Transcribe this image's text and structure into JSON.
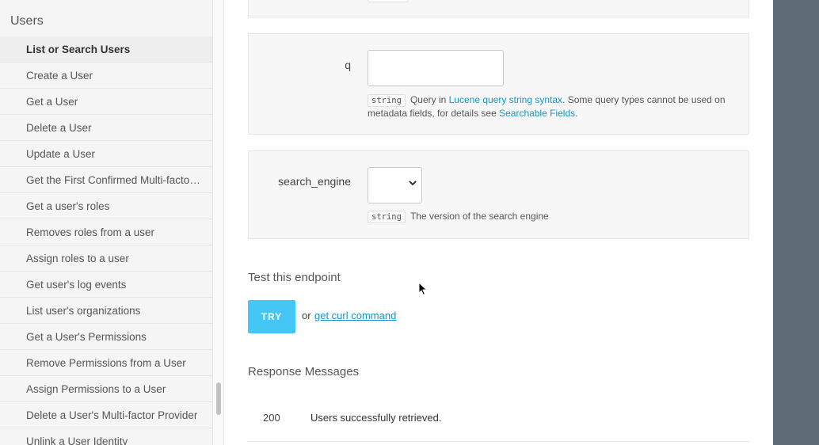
{
  "sidebar": {
    "title": "Users",
    "items": [
      {
        "label": "List or Search Users",
        "active": true
      },
      {
        "label": "Create a User"
      },
      {
        "label": "Get a User"
      },
      {
        "label": "Delete a User"
      },
      {
        "label": "Update a User"
      },
      {
        "label": "Get the First Confirmed Multi-factor Authentication Enrollment"
      },
      {
        "label": "Get a user's roles"
      },
      {
        "label": "Removes roles from a user"
      },
      {
        "label": "Assign roles to a user"
      },
      {
        "label": "Get user's log events"
      },
      {
        "label": "List user's organizations"
      },
      {
        "label": "Get a User's Permissions"
      },
      {
        "label": "Remove Permissions from a User"
      },
      {
        "label": "Assign Permissions to a User"
      },
      {
        "label": "Delete a User's Multi-factor Provider"
      },
      {
        "label": "Unlink a User Identity"
      }
    ]
  },
  "params": {
    "q": {
      "label": "q",
      "value": "",
      "type": "string",
      "desc_before": "Query in ",
      "link1": "Lucene query string syntax",
      "desc_middle": ". Some query types cannot be used on metadata fields, for details see ",
      "link2": "Searchable Fields",
      "desc_after": "."
    },
    "search_engine": {
      "label": "search_engine",
      "value": "",
      "type": "string",
      "desc": "The version of the search engine"
    }
  },
  "test": {
    "title": "Test this endpoint",
    "try_label": "TRY",
    "or_label": "or",
    "curl_label": "get curl command"
  },
  "responses": {
    "title": "Response Messages",
    "rows": [
      {
        "code": "200",
        "message": "Users successfully retrieved."
      }
    ]
  },
  "colors": {
    "accent": "#44c7f4",
    "link": "#1a93c5",
    "right_panel": "#5f6b75"
  }
}
